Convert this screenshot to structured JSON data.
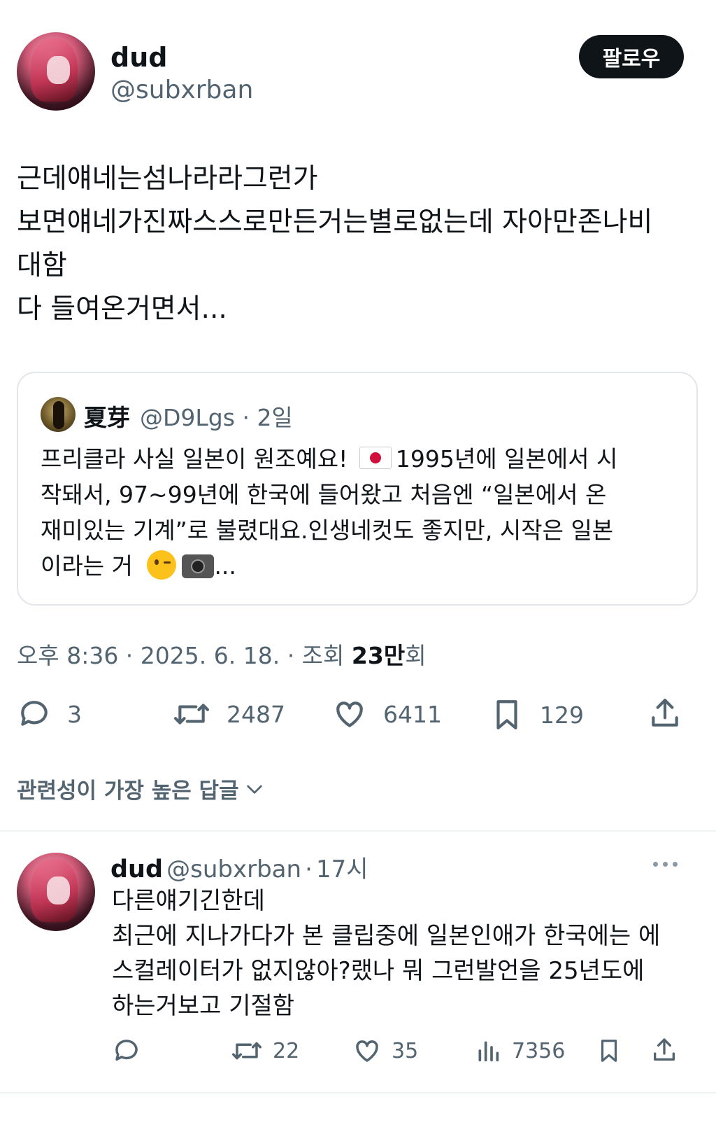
{
  "tweet": {
    "author_name": "dud",
    "author_handle": "@subxrban",
    "follow_label": "팔로우",
    "text_lines": [
      "근데얘네는섬나라라그런가",
      "보면얘네가진짜스스로만든거는별로없는데 자아만존나비",
      "대함",
      "다 들여온거면서..."
    ],
    "quote": {
      "author_name": "夏芽",
      "author_handle": "@D9Lgs",
      "time": "2일",
      "text_lines": [
        "프리클라 사실 일본이 원조예요!",
        "1995년에 일본에서 시",
        "작돼서, 97~99년에 한국에 들어왔고 처음엔 “일본에서 온",
        "재미있는 기계”로 불렸대요.인생네컷도 좋지만, 시작은 일본",
        "이라는 거",
        "..."
      ]
    },
    "timestamp": "오후 8:36 · 2025. 6. 18. · 조회",
    "views_count": "23만",
    "views_suffix": "회",
    "stats": {
      "replies": "3",
      "retweets": "2487",
      "likes": "6411",
      "bookmarks": "129"
    }
  },
  "replies_sort": {
    "label": "관련성이 가장 높은 답글"
  },
  "reply": {
    "author_name": "dud",
    "author_handle": "@subxrban",
    "time": "17시",
    "text_lines": [
      "다른얘기긴한데",
      "최근에 지나가다가 본 클립중에 일본인애가 한국에는 에",
      "스컬레이터가 없지않아?랬나 뭐 그런발언을 25년도에",
      "하는거보고 기절함"
    ],
    "stats": {
      "retweets": "22",
      "likes": "35",
      "views": "7356"
    }
  },
  "separator": "·",
  "icons": [
    "more-icon",
    "reply-icon",
    "retweet-icon",
    "like-icon",
    "bookmark-icon",
    "share-icon",
    "views-icon",
    "chevron-down-icon"
  ]
}
